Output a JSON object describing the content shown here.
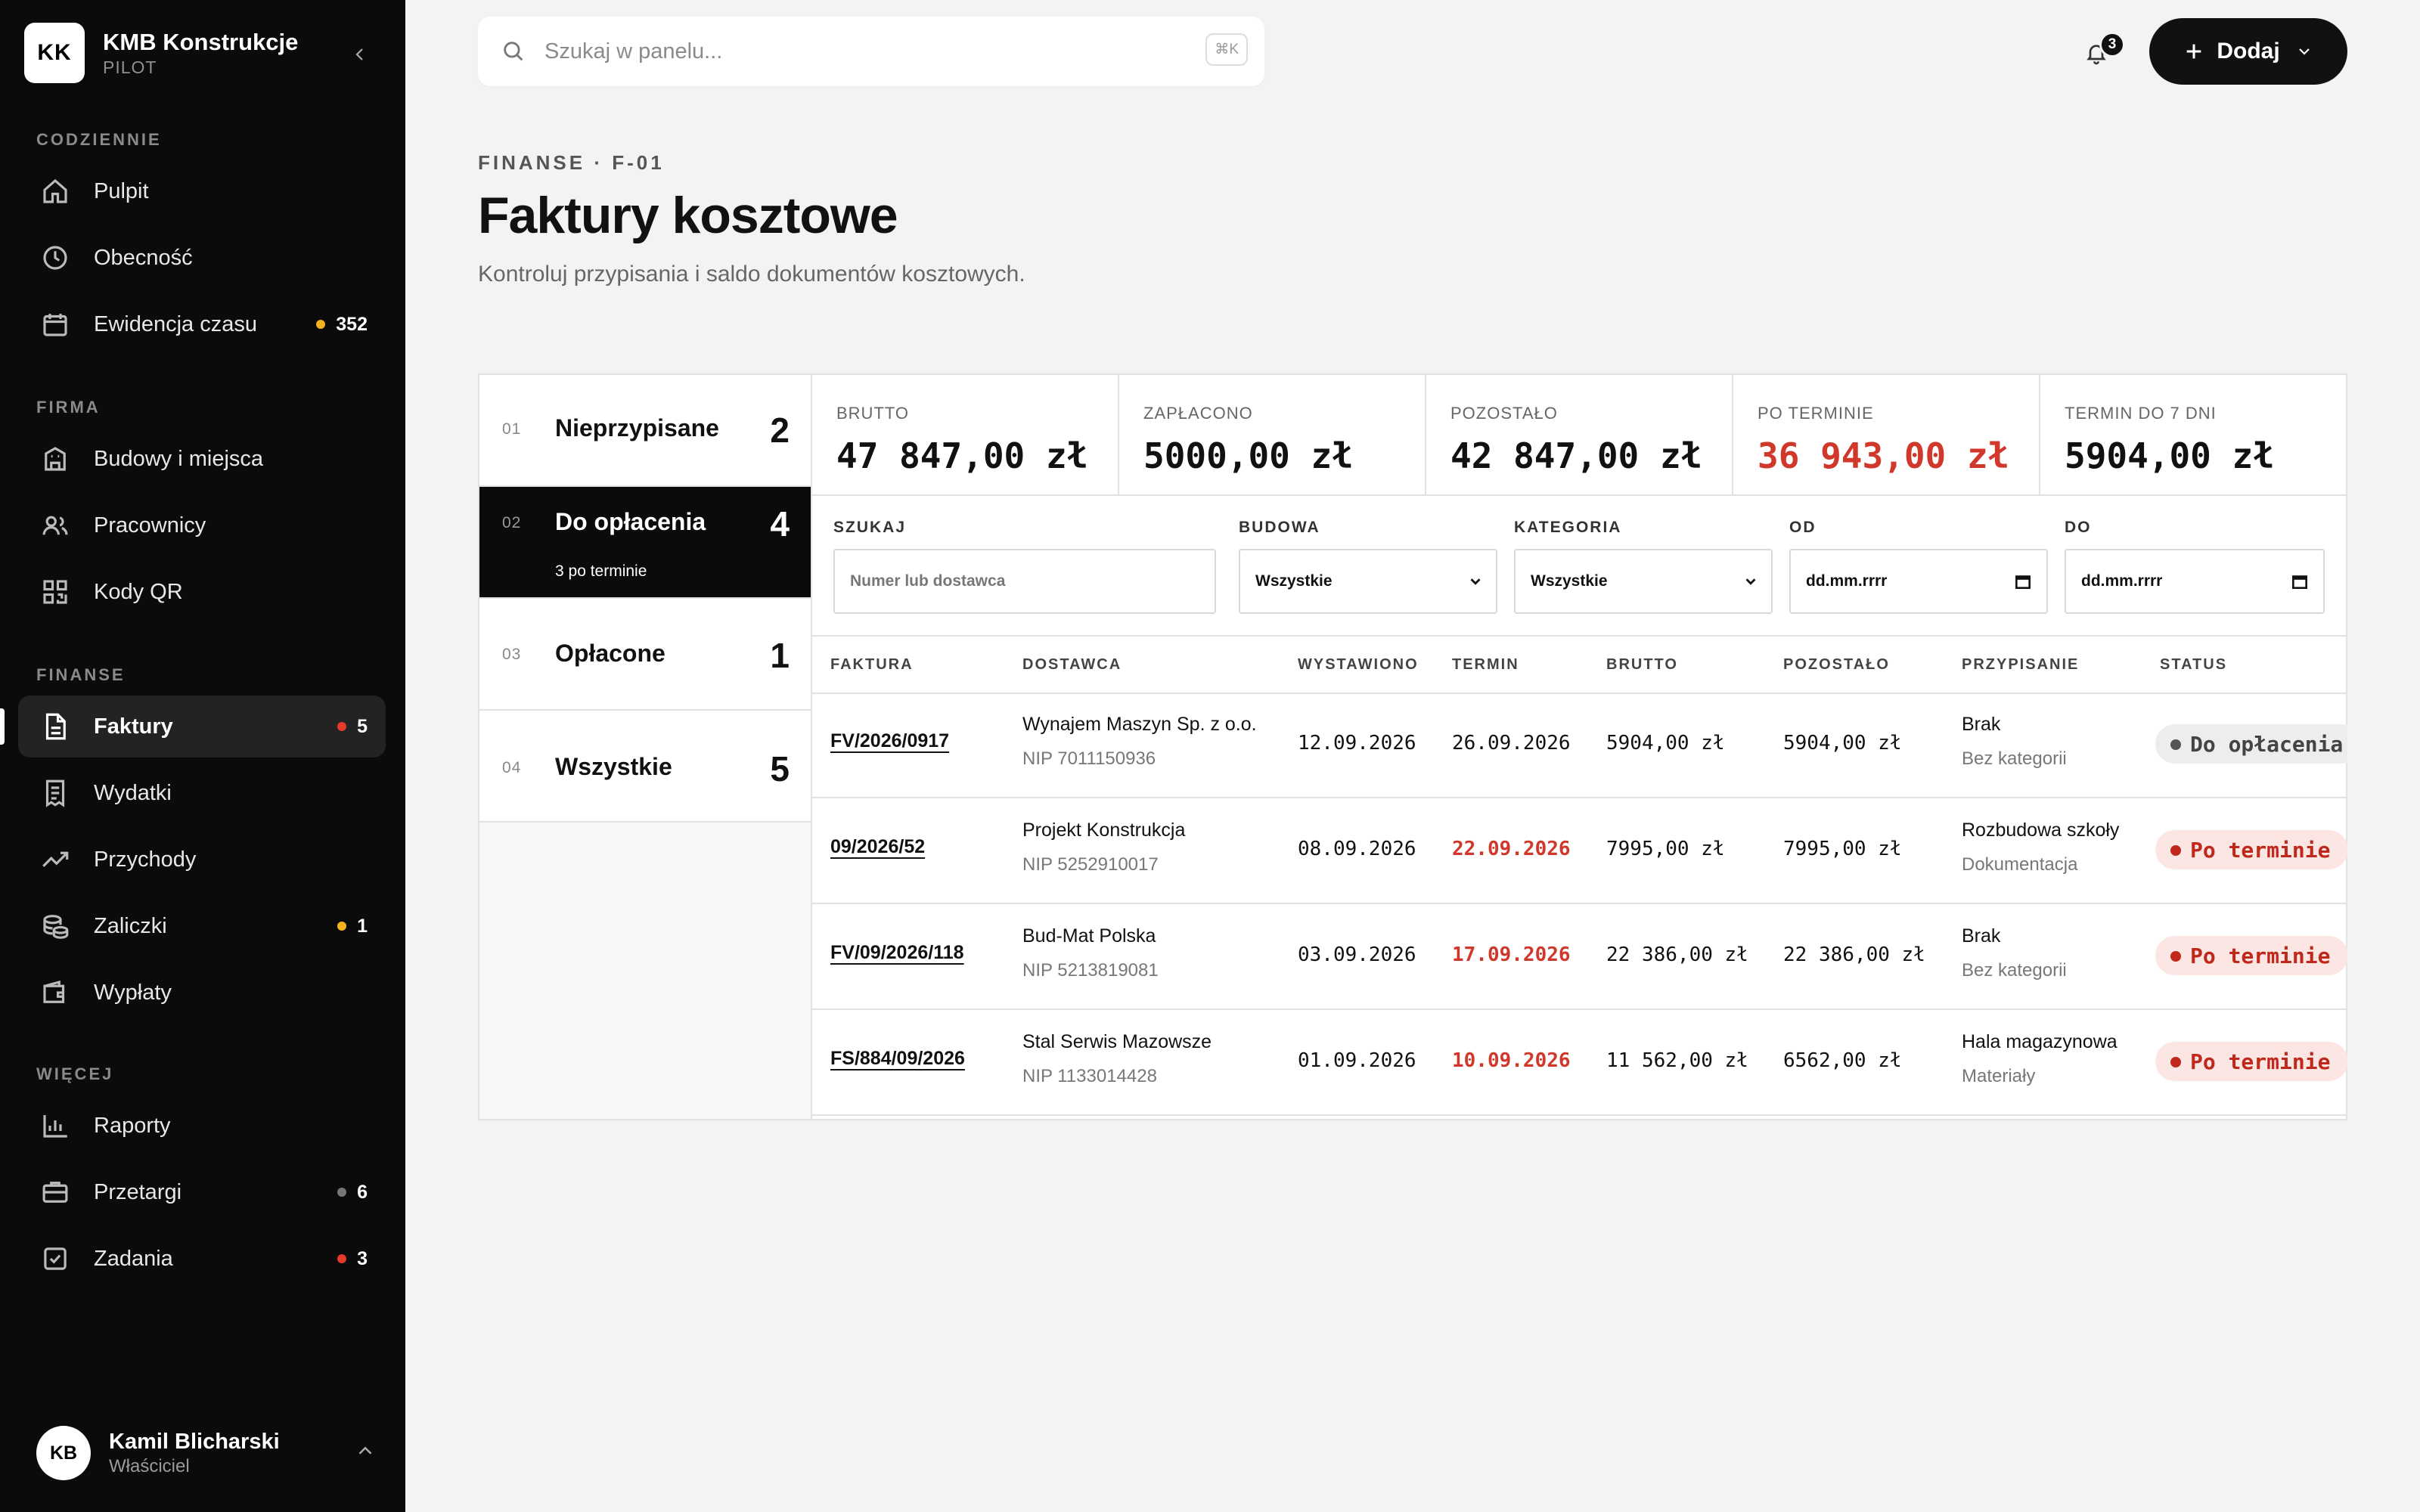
{
  "brand": {
    "logo": "KK",
    "name": "KMB Konstrukcje",
    "sub": "PILOT"
  },
  "sidebar": {
    "sections": [
      {
        "label": "CODZIENNIE"
      },
      {
        "label": "FIRMA"
      },
      {
        "label": "FINANSE"
      },
      {
        "label": "WIĘCEJ"
      }
    ],
    "items": [
      {
        "label": "Pulpit",
        "icon": "home-icon"
      },
      {
        "label": "Obecność",
        "icon": "clock-icon"
      },
      {
        "label": "Ewidencja czasu",
        "icon": "calendar-icon",
        "badge": "352",
        "badge_color": "#f2b51d"
      },
      {
        "label": "Budowy i miejsca",
        "icon": "building-icon"
      },
      {
        "label": "Pracownicy",
        "icon": "users-icon"
      },
      {
        "label": "Kody QR",
        "icon": "qr-icon"
      },
      {
        "label": "Faktury",
        "icon": "document-icon",
        "badge": "5",
        "badge_color": "#e5392b",
        "active": true
      },
      {
        "label": "Wydatki",
        "icon": "receipt-icon"
      },
      {
        "label": "Przychody",
        "icon": "trend-up-icon"
      },
      {
        "label": "Zaliczki",
        "icon": "coins-icon",
        "badge": "1",
        "badge_color": "#f2b51d"
      },
      {
        "label": "Wypłaty",
        "icon": "wallet-icon"
      },
      {
        "label": "Raporty",
        "icon": "bar-chart-icon"
      },
      {
        "label": "Przetargi",
        "icon": "briefcase-icon",
        "badge": "6",
        "badge_color": "#777777"
      },
      {
        "label": "Zadania",
        "icon": "checkbox-icon",
        "badge": "3",
        "badge_color": "#e5392b"
      }
    ]
  },
  "user": {
    "initials": "KB",
    "name": "Kamil Blicharski",
    "role": "Właściciel"
  },
  "topbar": {
    "search_placeholder": "Szukaj w panelu...",
    "shortcut": "⌘K",
    "notifications": "3",
    "add_label": "Dodaj"
  },
  "header": {
    "breadcrumb": "FINANSE · F-01",
    "title": "Faktury kosztowe",
    "subtitle": "Kontroluj przypisania i saldo dokumentów kosztowych."
  },
  "tabs": [
    {
      "num": "01",
      "label": "Nieprzypisane",
      "count": "2"
    },
    {
      "num": "02",
      "label": "Do opłacenia",
      "count": "4",
      "sub": "3 po terminie",
      "active": true
    },
    {
      "num": "03",
      "label": "Opłacone",
      "count": "1"
    },
    {
      "num": "04",
      "label": "Wszystkie",
      "count": "5"
    }
  ],
  "stats": [
    {
      "label": "BRUTTO",
      "value": "47 847,00 zł"
    },
    {
      "label": "ZAPŁACONO",
      "value": "5000,00 zł"
    },
    {
      "label": "POZOSTAŁO",
      "value": "42 847,00 zł"
    },
    {
      "label": "PO TERMINIE",
      "value": "36 943,00 zł",
      "alert": true
    },
    {
      "label": "TERMIN DO 7 DNI",
      "value": "5904,00 zł"
    }
  ],
  "filters": {
    "search": {
      "label": "SZUKAJ",
      "placeholder": "Numer lub dostawca"
    },
    "site": {
      "label": "BUDOWA",
      "value": "Wszystkie"
    },
    "category": {
      "label": "KATEGORIA",
      "value": "Wszystkie"
    },
    "from": {
      "label": "OD",
      "value": "dd.mm.rrrr"
    },
    "to": {
      "label": "DO",
      "value": "dd.mm.rrrr"
    }
  },
  "table": {
    "columns": [
      "FAKTURA",
      "DOSTAWCA",
      "WYSTAWIONO",
      "TERMIN",
      "BRUTTO",
      "POZOSTAŁO",
      "PRZYPISANIE",
      "STATUS"
    ],
    "rows": [
      {
        "invoice": "FV/2026/0917",
        "supplier": "Wynajem Maszyn Sp. z o.o.",
        "nip": "NIP 7011150936",
        "issued": "12.09.2026",
        "due": "26.09.2026",
        "overdue": false,
        "gross": "5904,00 zł",
        "remaining": "5904,00 zł",
        "assignment": "Brak",
        "category": "Bez kategorii",
        "status": "Do opłacenia",
        "status_kind": "gray"
      },
      {
        "invoice": "09/2026/52",
        "supplier": "Projekt Konstrukcja",
        "nip": "NIP 5252910017",
        "issued": "08.09.2026",
        "due": "22.09.2026",
        "overdue": true,
        "gross": "7995,00 zł",
        "remaining": "7995,00 zł",
        "assignment": "Rozbudowa szkoły",
        "category": "Dokumentacja",
        "status": "Po terminie",
        "status_kind": "red"
      },
      {
        "invoice": "FV/09/2026/118",
        "supplier": "Bud-Mat Polska",
        "nip": "NIP 5213819081",
        "issued": "03.09.2026",
        "due": "17.09.2026",
        "overdue": true,
        "gross": "22 386,00 zł",
        "remaining": "22 386,00 zł",
        "assignment": "Brak",
        "category": "Bez kategorii",
        "status": "Po terminie",
        "status_kind": "red"
      },
      {
        "invoice": "FS/884/09/2026",
        "supplier": "Stal Serwis Mazowsze",
        "nip": "NIP 1133014428",
        "issued": "01.09.2026",
        "due": "10.09.2026",
        "overdue": true,
        "gross": "11 562,00 zł",
        "remaining": "6562,00 zł",
        "assignment": "Hala magazynowa",
        "category": "Materiały",
        "status": "Po terminie",
        "status_kind": "red"
      }
    ]
  }
}
